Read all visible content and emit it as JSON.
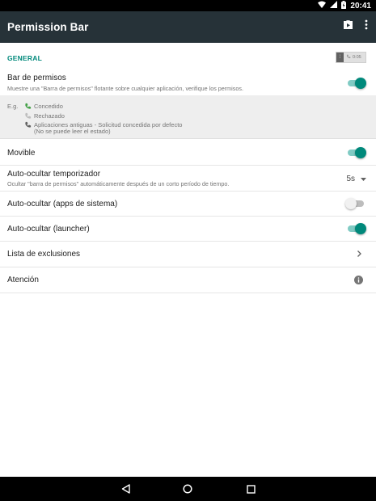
{
  "status_bar": {
    "time": "20:41",
    "icons": [
      "wifi-icon",
      "signal-icon",
      "battery-icon"
    ]
  },
  "app_bar": {
    "title": "Permission Bar",
    "actions": [
      "play-store-icon",
      "more-vert-icon"
    ]
  },
  "section": {
    "header": "GENERAL",
    "preview_time": "0:05"
  },
  "settings": {
    "bar": {
      "label": "Bar de permisos",
      "summary": "Muestre una \"Barra de permisos\" flotante sobre cualquier aplicación, verifique los permisos.",
      "enabled": true
    },
    "example": {
      "prefix": "E.g.",
      "items": [
        {
          "icon": "phone-granted-icon",
          "text": "Concedido"
        },
        {
          "icon": "phone-denied-icon",
          "text": "Rechazado"
        },
        {
          "icon": "phone-legacy-icon",
          "text": "Aplicaciones antiguas - Solicitud concedida por defecto"
        }
      ],
      "note": "(No se puede leer el estado)"
    },
    "movable": {
      "label": "Movible",
      "enabled": true
    },
    "timer": {
      "label": "Auto-ocultar temporizador",
      "summary": "Ocultar \"barra de permisos\" automáticamente después de un corto período de tiempo.",
      "value": "5s"
    },
    "hide_system": {
      "label": "Auto-ocultar (apps de sistema)",
      "enabled": false
    },
    "hide_launcher": {
      "label": "Auto-ocultar (launcher)",
      "enabled": true
    },
    "exclusions": {
      "label": "Lista de exclusiones"
    },
    "attention": {
      "label": "Atención"
    }
  },
  "colors": {
    "accent": "#00897b",
    "app_bar": "#263238",
    "status_bar": "#000000"
  },
  "nav_bar": [
    "back-icon",
    "home-icon",
    "recents-icon"
  ]
}
